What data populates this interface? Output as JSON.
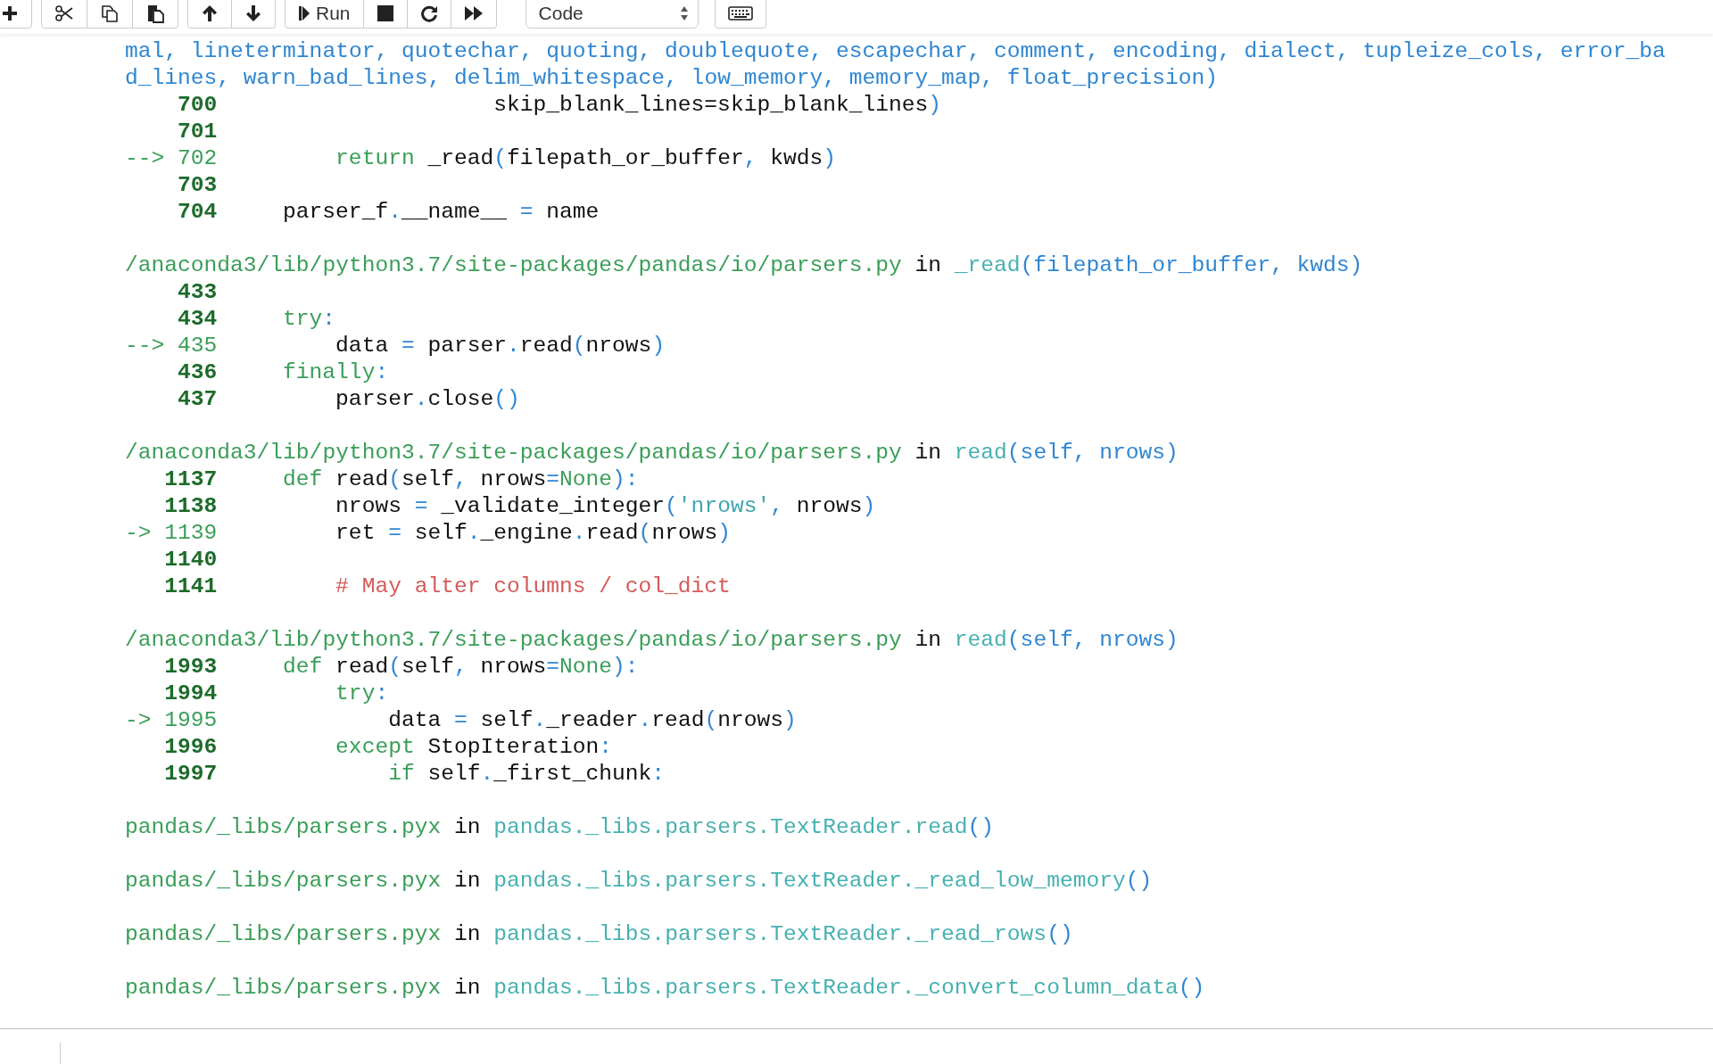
{
  "toolbar": {
    "run_label": "Run",
    "cell_type": "Code"
  },
  "traceback": {
    "sections": [
      {
        "wrapped_lines": [
          "mal, lineterminator, quotechar, quoting, doublequote, escapechar, comment, encoding, dialect, tupleize_cols, error_ba",
          "d_lines, warn_bad_lines, delim_whitespace, low_memory, memory_map, float_precision)"
        ],
        "lines": [
          {
            "number": "700",
            "current": false,
            "tokens": [
              {
                "kind": "plain",
                "text": "                    skip_blank_lines=skip_blank_lines"
              },
              {
                "kind": "op",
                "text": ")"
              }
            ]
          },
          {
            "number": "701",
            "current": false
          },
          {
            "number": "702",
            "current": true,
            "arrow": "-->",
            "tokens": [
              {
                "kind": "keyword",
                "text": "        return"
              },
              {
                "kind": "plain",
                "text": " _read"
              },
              {
                "kind": "op",
                "text": "("
              },
              {
                "kind": "plain",
                "text": "filepath_or_buffer"
              },
              {
                "kind": "op",
                "text": ","
              },
              {
                "kind": "plain",
                "text": " kwds"
              },
              {
                "kind": "op",
                "text": ")"
              }
            ]
          },
          {
            "number": "703",
            "current": false
          },
          {
            "number": "704",
            "current": false,
            "tokens": [
              {
                "kind": "plain",
                "text": "    parser_f"
              },
              {
                "kind": "op",
                "text": "."
              },
              {
                "kind": "plain",
                "text": "__name__ "
              },
              {
                "kind": "op",
                "text": "="
              },
              {
                "kind": "plain",
                "text": " name"
              }
            ]
          }
        ]
      },
      {
        "header": [
          {
            "kind": "path",
            "text": "/anaconda3/lib/python3.7/site-packages/pandas/io/parsers.py"
          },
          {
            "kind": "plain",
            "text": " in "
          },
          {
            "kind": "func",
            "text": "_read"
          },
          {
            "kind": "args",
            "text": "(filepath_or_buffer, kwds)"
          }
        ],
        "lines": [
          {
            "number": "433",
            "current": false
          },
          {
            "number": "434",
            "current": false,
            "tokens": [
              {
                "kind": "keyword",
                "text": "    try"
              },
              {
                "kind": "op",
                "text": ":"
              }
            ]
          },
          {
            "number": "435",
            "current": true,
            "arrow": "-->",
            "tokens": [
              {
                "kind": "plain",
                "text": "        data "
              },
              {
                "kind": "op",
                "text": "="
              },
              {
                "kind": "plain",
                "text": " parser"
              },
              {
                "kind": "op",
                "text": "."
              },
              {
                "kind": "plain",
                "text": "read"
              },
              {
                "kind": "op",
                "text": "("
              },
              {
                "kind": "plain",
                "text": "nrows"
              },
              {
                "kind": "op",
                "text": ")"
              }
            ]
          },
          {
            "number": "436",
            "current": false,
            "tokens": [
              {
                "kind": "keyword",
                "text": "    finally"
              },
              {
                "kind": "op",
                "text": ":"
              }
            ]
          },
          {
            "number": "437",
            "current": false,
            "tokens": [
              {
                "kind": "plain",
                "text": "        parser"
              },
              {
                "kind": "op",
                "text": "."
              },
              {
                "kind": "plain",
                "text": "close"
              },
              {
                "kind": "op",
                "text": "()"
              }
            ]
          }
        ]
      },
      {
        "header": [
          {
            "kind": "path",
            "text": "/anaconda3/lib/python3.7/site-packages/pandas/io/parsers.py"
          },
          {
            "kind": "plain",
            "text": " in "
          },
          {
            "kind": "func",
            "text": "read"
          },
          {
            "kind": "args",
            "text": "(self, nrows)"
          }
        ],
        "lines": [
          {
            "number": "1137",
            "current": false,
            "tokens": [
              {
                "kind": "keyword",
                "text": "    def"
              },
              {
                "kind": "plain",
                "text": " read"
              },
              {
                "kind": "op",
                "text": "("
              },
              {
                "kind": "plain",
                "text": "self"
              },
              {
                "kind": "op",
                "text": ","
              },
              {
                "kind": "plain",
                "text": " nrows"
              },
              {
                "kind": "op",
                "text": "="
              },
              {
                "kind": "keyword",
                "text": "None"
              },
              {
                "kind": "op",
                "text": "):"
              }
            ]
          },
          {
            "number": "1138",
            "current": false,
            "tokens": [
              {
                "kind": "plain",
                "text": "        nrows "
              },
              {
                "kind": "op",
                "text": "="
              },
              {
                "kind": "plain",
                "text": " _validate_integer"
              },
              {
                "kind": "op",
                "text": "("
              },
              {
                "kind": "string",
                "text": "'nrows'"
              },
              {
                "kind": "op",
                "text": ","
              },
              {
                "kind": "plain",
                "text": " nrows"
              },
              {
                "kind": "op",
                "text": ")"
              }
            ]
          },
          {
            "number": "1139",
            "current": true,
            "arrow": "->",
            "tokens": [
              {
                "kind": "plain",
                "text": "        ret "
              },
              {
                "kind": "op",
                "text": "="
              },
              {
                "kind": "plain",
                "text": " self"
              },
              {
                "kind": "op",
                "text": "."
              },
              {
                "kind": "plain",
                "text": "_engine"
              },
              {
                "kind": "op",
                "text": "."
              },
              {
                "kind": "plain",
                "text": "read"
              },
              {
                "kind": "op",
                "text": "("
              },
              {
                "kind": "plain",
                "text": "nrows"
              },
              {
                "kind": "op",
                "text": ")"
              }
            ]
          },
          {
            "number": "1140",
            "current": false
          },
          {
            "number": "1141",
            "current": false,
            "tokens": [
              {
                "kind": "comment",
                "text": "        # May alter columns / col_dict"
              }
            ]
          }
        ]
      },
      {
        "header": [
          {
            "kind": "path",
            "text": "/anaconda3/lib/python3.7/site-packages/pandas/io/parsers.py"
          },
          {
            "kind": "plain",
            "text": " in "
          },
          {
            "kind": "func",
            "text": "read"
          },
          {
            "kind": "args",
            "text": "(self, nrows)"
          }
        ],
        "lines": [
          {
            "number": "1993",
            "current": false,
            "tokens": [
              {
                "kind": "keyword",
                "text": "    def"
              },
              {
                "kind": "plain",
                "text": " read"
              },
              {
                "kind": "op",
                "text": "("
              },
              {
                "kind": "plain",
                "text": "self"
              },
              {
                "kind": "op",
                "text": ","
              },
              {
                "kind": "plain",
                "text": " nrows"
              },
              {
                "kind": "op",
                "text": "="
              },
              {
                "kind": "keyword",
                "text": "None"
              },
              {
                "kind": "op",
                "text": "):"
              }
            ]
          },
          {
            "number": "1994",
            "current": false,
            "tokens": [
              {
                "kind": "keyword",
                "text": "        try"
              },
              {
                "kind": "op",
                "text": ":"
              }
            ]
          },
          {
            "number": "1995",
            "current": true,
            "arrow": "->",
            "tokens": [
              {
                "kind": "plain",
                "text": "            data "
              },
              {
                "kind": "op",
                "text": "="
              },
              {
                "kind": "plain",
                "text": " self"
              },
              {
                "kind": "op",
                "text": "."
              },
              {
                "kind": "plain",
                "text": "_reader"
              },
              {
                "kind": "op",
                "text": "."
              },
              {
                "kind": "plain",
                "text": "read"
              },
              {
                "kind": "op",
                "text": "("
              },
              {
                "kind": "plain",
                "text": "nrows"
              },
              {
                "kind": "op",
                "text": ")"
              }
            ]
          },
          {
            "number": "1996",
            "current": false,
            "tokens": [
              {
                "kind": "keyword",
                "text": "        except"
              },
              {
                "kind": "plain",
                "text": " StopIteration"
              },
              {
                "kind": "op",
                "text": ":"
              }
            ]
          },
          {
            "number": "1997",
            "current": false,
            "tokens": [
              {
                "kind": "keyword",
                "text": "            if"
              },
              {
                "kind": "plain",
                "text": " self"
              },
              {
                "kind": "op",
                "text": "."
              },
              {
                "kind": "plain",
                "text": "_first_chunk"
              },
              {
                "kind": "op",
                "text": ":"
              }
            ]
          }
        ]
      },
      {
        "header": [
          {
            "kind": "path",
            "text": "pandas/_libs/parsers.pyx"
          },
          {
            "kind": "plain",
            "text": " in "
          },
          {
            "kind": "func",
            "text": "pandas._libs.parsers.TextReader.read"
          },
          {
            "kind": "args",
            "text": "()"
          }
        ]
      },
      {
        "header": [
          {
            "kind": "path",
            "text": "pandas/_libs/parsers.pyx"
          },
          {
            "kind": "plain",
            "text": " in "
          },
          {
            "kind": "func",
            "text": "pandas._libs.parsers.TextReader._read_low_memory"
          },
          {
            "kind": "args",
            "text": "()"
          }
        ]
      },
      {
        "header": [
          {
            "kind": "path",
            "text": "pandas/_libs/parsers.pyx"
          },
          {
            "kind": "plain",
            "text": " in "
          },
          {
            "kind": "func",
            "text": "pandas._libs.parsers.TextReader._read_rows"
          },
          {
            "kind": "args",
            "text": "()"
          }
        ]
      },
      {
        "header": [
          {
            "kind": "path",
            "text": "pandas/_libs/parsers.pyx"
          },
          {
            "kind": "plain",
            "text": " in "
          },
          {
            "kind": "func",
            "text": "pandas._libs.parsers.TextReader._convert_column_data"
          },
          {
            "kind": "args",
            "text": "()"
          }
        ]
      }
    ]
  }
}
